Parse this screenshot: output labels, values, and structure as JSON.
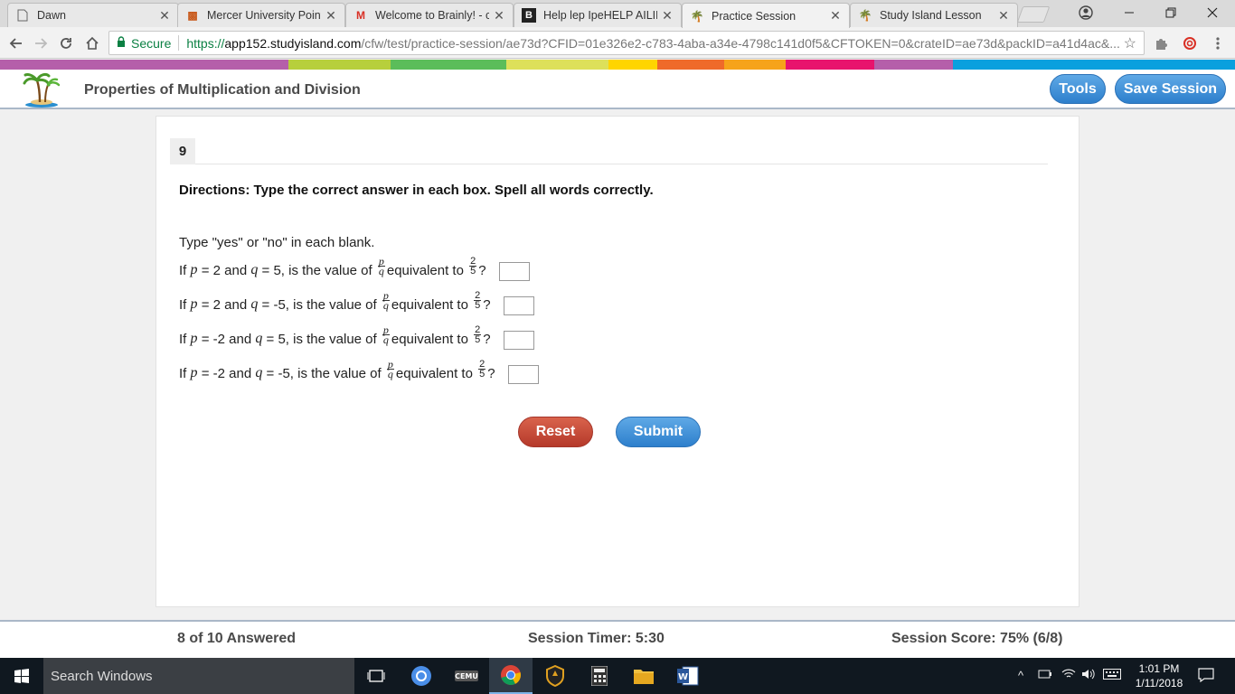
{
  "browser": {
    "tabs": [
      {
        "title": "Dawn",
        "icon": "document-icon"
      },
      {
        "title": "Mercer University Point",
        "icon": "mercer-icon"
      },
      {
        "title": "Welcome to Brainly! - c",
        "icon": "gmail-icon"
      },
      {
        "title": "Help lep IpeHELP AILIE",
        "icon": "brainly-icon"
      },
      {
        "title": "Practice Session",
        "icon": "palm-tree-icon"
      },
      {
        "title": "Study Island Lesson",
        "icon": "palm-tree-icon"
      }
    ],
    "security_label": "Secure",
    "url_scheme": "https://",
    "url_host": "app152.studyisland.com",
    "url_path": "/cfw/test/practice-session/ae73d?CFID=01e326e2-c783-4aba-a34e-4798c141d0f5&CFTOKEN=0&crateID=ae73d&packID=a41d4ac&..."
  },
  "colors": {
    "rainbow": [
      "#b55faa",
      "#b55faa",
      "#b7cf3c",
      "#5bbd5a",
      "#dde05a",
      "#ffd500",
      "#ef6a2a",
      "#f6a31a",
      "#e8136d",
      "#b55faa",
      "#0aa0de"
    ],
    "primary_button": "#3a8ad6",
    "reset_button": "#c44a36"
  },
  "header": {
    "title": "Properties of Multiplication and Division",
    "tools_label": "Tools",
    "save_label": "Save Session"
  },
  "question": {
    "number": "9",
    "directions": "Directions: Type the correct answer in each box. Spell all words correctly.",
    "instruction": "Type \"yes\" or \"no\" in each blank.",
    "rows": [
      {
        "p": "2",
        "q": "5"
      },
      {
        "p": "2",
        "q": "-5"
      },
      {
        "p": "-2",
        "q": "5"
      },
      {
        "p": "-2",
        "q": "-5"
      }
    ],
    "text": {
      "if": "If",
      "and": "and",
      "eq": "=",
      "comma": ", is the value of",
      "equivalent": "equivalent to",
      "p": "p",
      "q": "q",
      "target_num": "2",
      "target_den": "5",
      "qmark": "?"
    },
    "reset_label": "Reset",
    "submit_label": "Submit"
  },
  "status": {
    "answered": "8 of 10 Answered",
    "timer": "Session Timer: 5:30",
    "score": "Session Score: 75% (6/8)"
  },
  "taskbar": {
    "search_placeholder": "Search Windows",
    "time": "1:01 PM",
    "date": "1/11/2018"
  }
}
